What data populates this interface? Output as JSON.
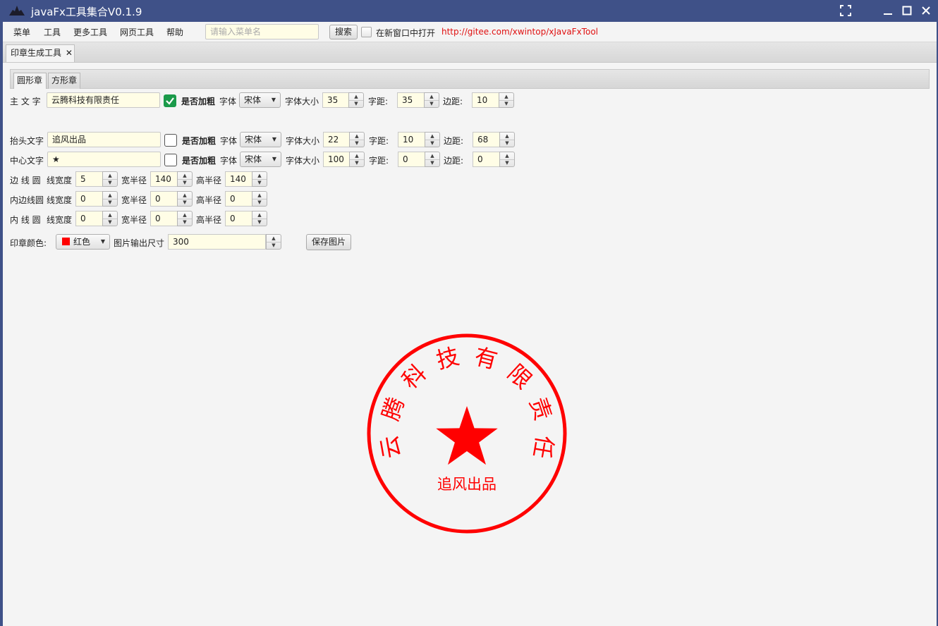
{
  "window": {
    "title": "javaFx工具集合V0.1.9"
  },
  "menubar": {
    "items": [
      "菜单",
      "工具",
      "更多工具",
      "网页工具",
      "帮助"
    ],
    "search_placeholder": "请输入菜单名",
    "search_button": "搜索",
    "new_window_label": "在新窗口中打开",
    "link": "http://gitee.com/xwintop/xJavaFxTool"
  },
  "outer_tab": {
    "label": "印章生成工具",
    "close": "✕"
  },
  "inner_tabs": [
    "圆形章",
    "方形章"
  ],
  "rows": {
    "main": {
      "label": "主 文 字",
      "value": "云腾科技有限责任",
      "bold_checked": true,
      "bold_label": "是否加粗",
      "font_label": "字体",
      "font_value": "宋体",
      "size_label": "字体大小",
      "size_value": "35",
      "spacing_label": "字距:",
      "spacing_value": "35",
      "margin_label": "边距:",
      "margin_value": "10"
    },
    "header": {
      "label": "抬头文字",
      "value": "追风出品",
      "bold_checked": false,
      "bold_label": "是否加粗",
      "font_label": "字体",
      "font_value": "宋体",
      "size_label": "字体大小",
      "size_value": "22",
      "spacing_label": "字距:",
      "spacing_value": "10",
      "margin_label": "边距:",
      "margin_value": "68"
    },
    "center": {
      "label": "中心文字",
      "value": "★",
      "bold_checked": false,
      "bold_label": "是否加粗",
      "font_label": "字体",
      "font_value": "宋体",
      "size_label": "字体大小",
      "size_value": "100",
      "spacing_label": "字距:",
      "spacing_value": "0",
      "margin_label": "边距:",
      "margin_value": "0"
    }
  },
  "circles": {
    "line_width_label": "线宽度",
    "width_radius_label": "宽半径",
    "height_radius_label": "高半径",
    "border": {
      "label": "边 线 圆",
      "line_width": "5",
      "width_radius": "140",
      "height_radius": "140"
    },
    "inner_border": {
      "label": "内边线圆",
      "line_width": "0",
      "width_radius": "0",
      "height_radius": "0"
    },
    "inner": {
      "label": "内 线 圆",
      "line_width": "0",
      "width_radius": "0",
      "height_radius": "0"
    }
  },
  "bottom": {
    "color_label": "印章颜色:",
    "color_value": "红色",
    "color_hex": "#ff0000",
    "size_label": "图片输出尺寸",
    "size_value": "300",
    "save_button": "保存图片"
  },
  "stamp": {
    "top_text": "云腾科技有限责任",
    "bottom_text": "追风出品",
    "center_symbol": "★",
    "color": "#ff0000"
  }
}
